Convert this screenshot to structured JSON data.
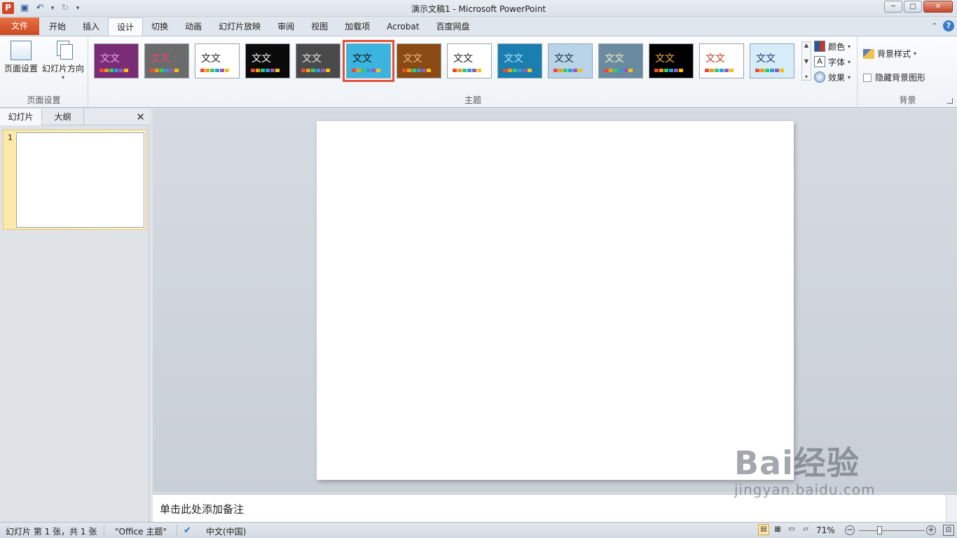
{
  "titlebar": {
    "window_title": "演示文稿1 - Microsoft PowerPoint",
    "app_icon_letter": "P",
    "qat": [
      "save-icon",
      "undo-icon",
      "redo-icon",
      "customize-qat-icon"
    ],
    "buttons": {
      "minimize": "─",
      "maximize": "□",
      "close": "✕"
    }
  },
  "menubar": {
    "file_tab": "文件",
    "tabs": [
      "开始",
      "插入",
      "设计",
      "切换",
      "动画",
      "幻灯片放映",
      "审阅",
      "视图",
      "加载项",
      "Acrobat",
      "百度网盘"
    ],
    "active_tab": "设计"
  },
  "ribbon": {
    "page_setup_group": {
      "label": "页面设置",
      "page_setup_button": "页面设置",
      "orientation_button": "幻灯片方向"
    },
    "themes_group": {
      "label": "主题",
      "theme_sample_text": "文文",
      "selected_index": 5,
      "themes": [
        {
          "bg": "#7b2c77",
          "text": "#e8a8e0"
        },
        {
          "bg": "#6b6b6b",
          "text": "#e84a7a"
        },
        {
          "bg": "#ffffff",
          "text": "#222222"
        },
        {
          "bg": "#0a0a0a",
          "text": "#ffffff"
        },
        {
          "bg": "#4a4a4a",
          "text": "#e8e8e8"
        },
        {
          "bg": "#3bb4e0",
          "text": "#111111"
        },
        {
          "bg": "#8a4a14",
          "text": "#f0c080"
        },
        {
          "bg": "#ffffff",
          "text": "#222222"
        },
        {
          "bg": "#1a7fb0",
          "text": "#aee6ff"
        },
        {
          "bg": "#b8d4e8",
          "text": "#1b2a3a"
        },
        {
          "bg": "#6a8aa0",
          "text": "#f4f0c0"
        },
        {
          "bg": "#000000",
          "text": "#ffb040"
        },
        {
          "bg": "#ffffff",
          "text": "#c0391b"
        },
        {
          "bg": "#d6ecf8",
          "text": "#1e3a6a"
        }
      ]
    },
    "theme_options": {
      "colors": "颜色",
      "fonts": "字体",
      "effects": "效果"
    },
    "background_group": {
      "label": "背景",
      "background_styles": "背景样式",
      "hide_background_graphics": "隐藏背景图形"
    }
  },
  "left_panel": {
    "tab_slides": "幻灯片",
    "tab_outline": "大纲",
    "close": "✕",
    "slide_number": "1"
  },
  "notes": {
    "placeholder": "单击此处添加备注"
  },
  "statusbar": {
    "slide_info": "幻灯片 第 1 张，共 1 张",
    "theme_name": "\"Office 主题\"",
    "language": "中文(中国)",
    "zoom": "71%",
    "zoom_minus": "−",
    "zoom_plus": "+"
  },
  "watermark": {
    "logo": "Bai经验",
    "url": "jingyan.baidu.com"
  }
}
